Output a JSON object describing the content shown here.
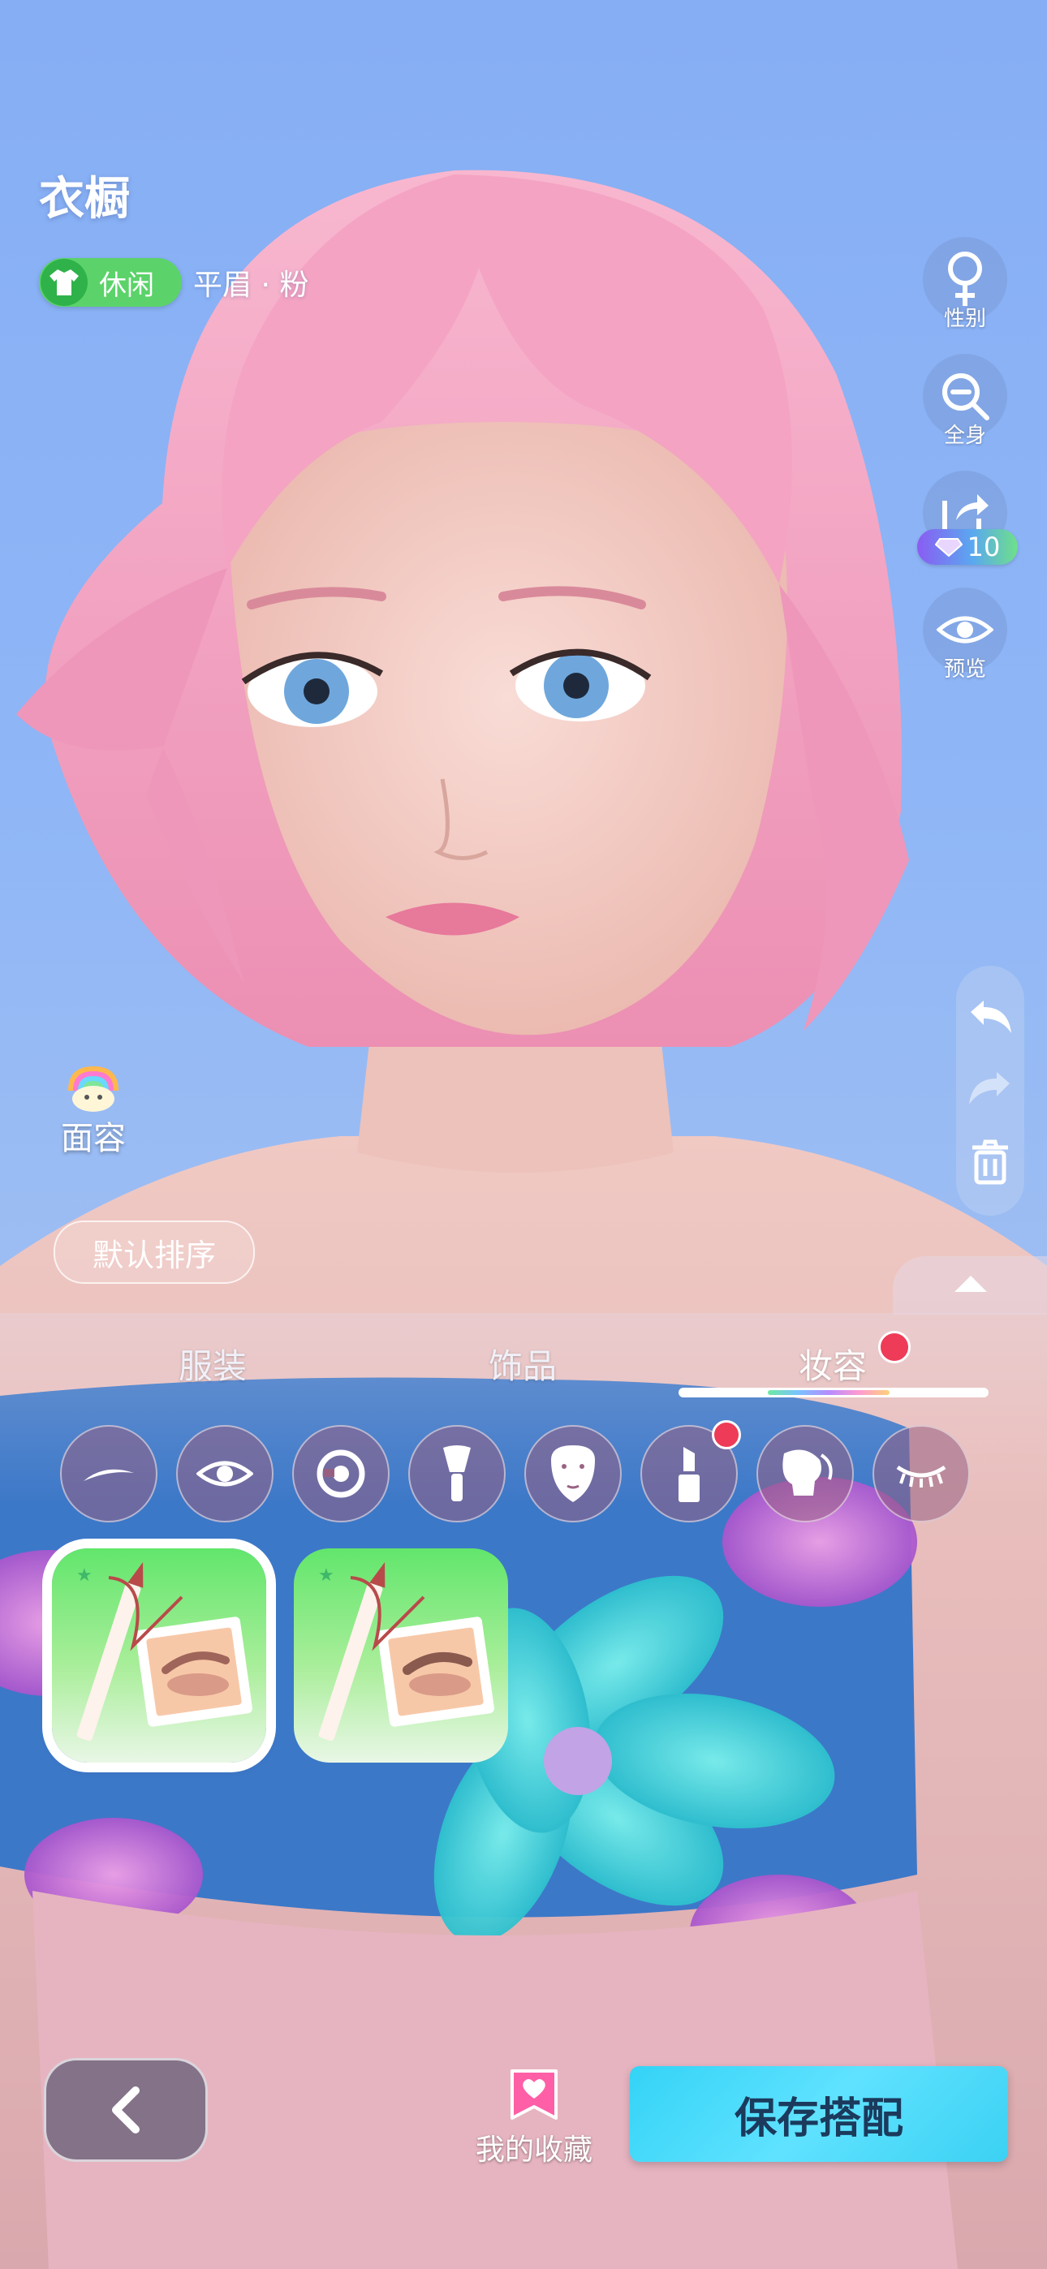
{
  "header": {
    "title": "衣橱",
    "tag_label": "休闲",
    "subtitle": "平眉 · 粉"
  },
  "side_tools": {
    "gender": "性别",
    "full_body": "全身",
    "share_diamonds": "10",
    "preview": "预览"
  },
  "face_button": {
    "label": "面容"
  },
  "sort_label": "默认排序",
  "tabs": [
    {
      "label": "服装",
      "active": false,
      "badge": false
    },
    {
      "label": "饰品",
      "active": false,
      "badge": false
    },
    {
      "label": "妆容",
      "active": true,
      "badge": true
    }
  ],
  "makeup_categories": [
    {
      "icon": "eyebrow-icon",
      "badge": false
    },
    {
      "icon": "eye-icon",
      "badge": false
    },
    {
      "icon": "iris-icon",
      "badge": false
    },
    {
      "icon": "makeup-brush-icon",
      "badge": false
    },
    {
      "icon": "face-mask-icon",
      "badge": false
    },
    {
      "icon": "lipstick-icon",
      "badge": true
    },
    {
      "icon": "face-profile-icon",
      "badge": false
    },
    {
      "icon": "eyelash-icon",
      "badge": false
    }
  ],
  "items": [
    {
      "icon": "eyebrow-pencil-icon",
      "selected": true
    },
    {
      "icon": "eyebrow-pencil-icon",
      "selected": false
    }
  ],
  "bottom_bar": {
    "favorites_label": "我的收藏",
    "save_label": "保存搭配"
  },
  "colors": {
    "tag_green": "#5bd36a",
    "badge_red": "#ee3b57",
    "save_cyan": "#34d3f6",
    "item_green": "#62e66c",
    "hair_pink": "#f3a0bf"
  }
}
